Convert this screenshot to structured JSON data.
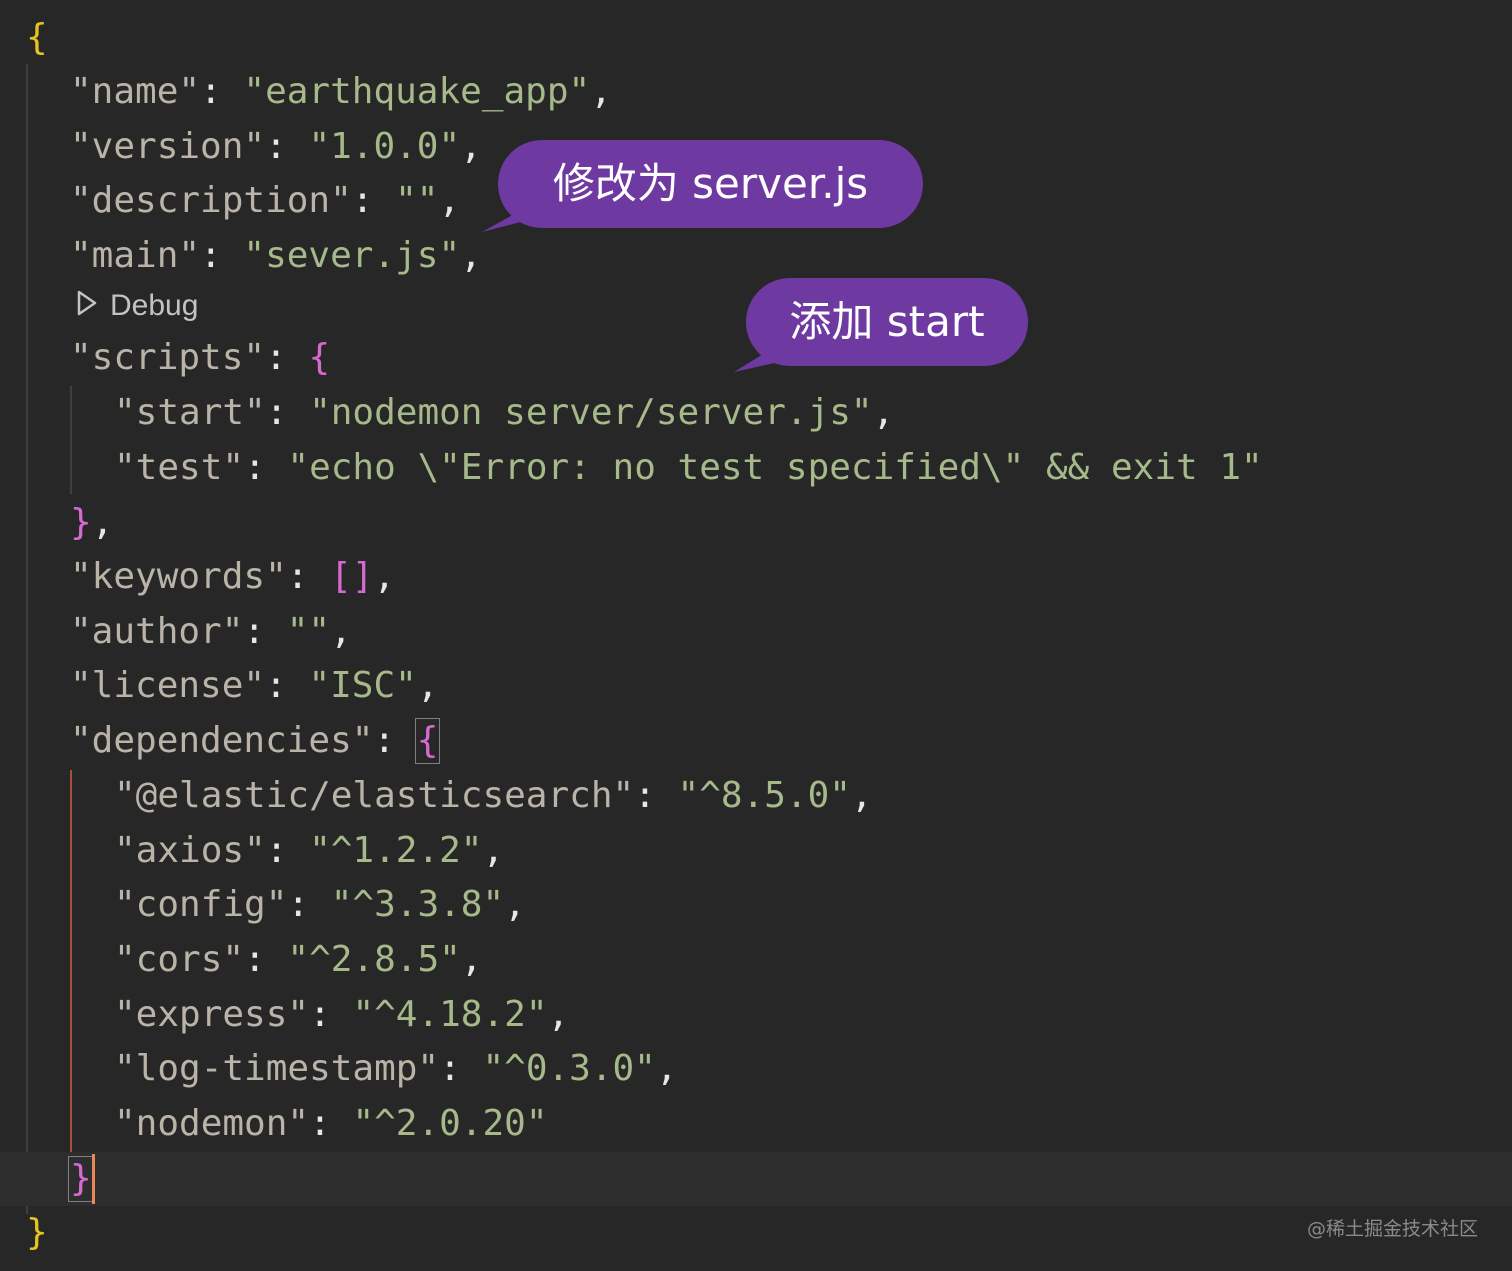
{
  "code": {
    "open_brace": "{",
    "name_key": "\"name\"",
    "name_value": "\"earthquake_app\"",
    "version_key": "\"version\"",
    "version_value": "\"1.0.0\"",
    "description_key": "\"description\"",
    "description_value": "\"\"",
    "main_key": "\"main\"",
    "main_value": "\"sever.js\"",
    "scripts_key": "\"scripts\"",
    "start_key": "\"start\"",
    "start_value": "\"nodemon server/server.js\"",
    "test_key": "\"test\"",
    "test_value": "\"echo \\\"Error: no test specified\\\" && exit 1\"",
    "keywords_key": "\"keywords\"",
    "keywords_value": "[]",
    "author_key": "\"author\"",
    "author_value": "\"\"",
    "license_key": "\"license\"",
    "license_value": "\"ISC\"",
    "dependencies_key": "\"dependencies\"",
    "dependencies": [
      {
        "key": "\"@elastic/elasticsearch\"",
        "value": "\"^8.5.0\""
      },
      {
        "key": "\"axios\"",
        "value": "\"^1.2.2\""
      },
      {
        "key": "\"config\"",
        "value": "\"^3.3.8\""
      },
      {
        "key": "\"cors\"",
        "value": "\"^2.8.5\""
      },
      {
        "key": "\"express\"",
        "value": "\"^4.18.2\""
      },
      {
        "key": "\"log-timestamp\"",
        "value": "\"^0.3.0\""
      },
      {
        "key": "\"nodemon\"",
        "value": "\"^2.0.20\""
      }
    ],
    "close_brace": "}"
  },
  "codelens": {
    "label": "Debug",
    "icon": "play-outline-icon"
  },
  "annotations": {
    "bubble1": "修改为 server.js",
    "bubble2": "添加 start",
    "color": "#6e3aa1"
  },
  "watermark": "@稀土掘金技术社区"
}
